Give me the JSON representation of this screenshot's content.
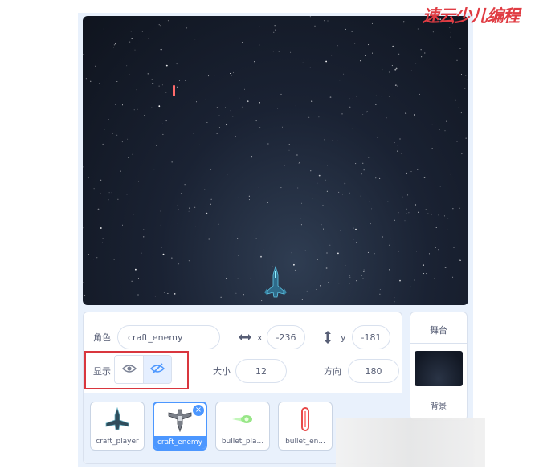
{
  "watermark": {
    "text": "速云少儿编程",
    "color": "#e03c43"
  },
  "sprite_info": {
    "sprite_label": "角色",
    "sprite_name": "craft_enemy",
    "x_label": "x",
    "x_value": "-236",
    "y_label": "y",
    "y_value": "-181",
    "show_label": "显示",
    "show_state": "hidden",
    "size_label": "大小",
    "size_value": "12",
    "direction_label": "方向",
    "direction_value": "180"
  },
  "sprites": [
    {
      "name": "craft_player",
      "selected": false,
      "icon": "player-craft-icon"
    },
    {
      "name": "craft_enemy",
      "selected": true,
      "icon": "enemy-craft-icon"
    },
    {
      "name": "bullet_pla...",
      "selected": false,
      "icon": "green-bullet-icon"
    },
    {
      "name": "bullet_en...",
      "selected": false,
      "icon": "red-bullet-icon"
    }
  ],
  "stage_pane": {
    "title": "舞台",
    "backdrop_label": "背景"
  },
  "colors": {
    "accent": "#4c97ff",
    "highlight": "#d9363e",
    "pane_bg": "#e9f1fc"
  }
}
